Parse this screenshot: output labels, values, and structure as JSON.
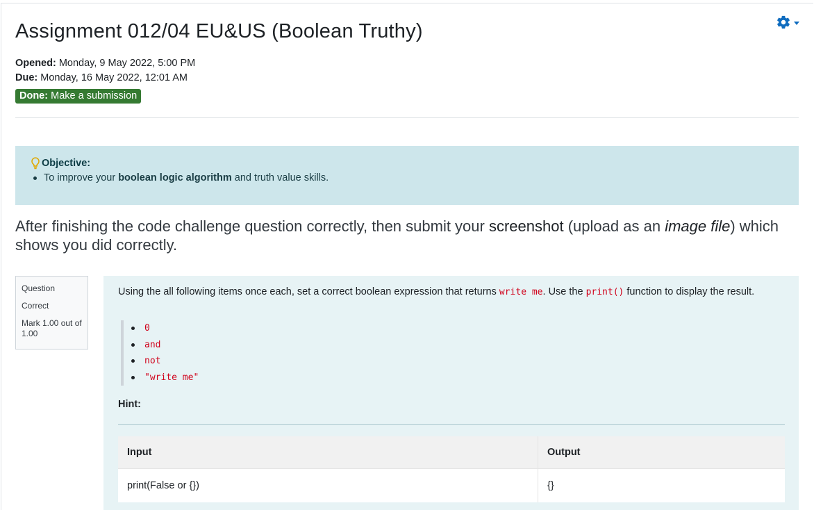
{
  "page": {
    "title": "Assignment 012/04 EU&US (Boolean Truthy)",
    "opened_label": "Opened:",
    "opened_value": "Monday, 9 May 2022, 5:00 PM",
    "due_label": "Due:",
    "due_value": "Monday, 16 May 2022, 12:01 AM",
    "done_label": "Done:",
    "done_value": "Make a submission",
    "done_color": "#357a32"
  },
  "toolbar": {
    "settings_icon": "gear-icon",
    "accent": "#0f6cbf"
  },
  "objective": {
    "icon": "lightbulb-icon",
    "title": "Objective:",
    "item_prefix": "To improve your",
    "item_bold": "boolean logic algorithm",
    "item_suffix": "and truth value skills.",
    "background": "#cde6eb"
  },
  "instructions": {
    "part1": "After finishing the code challenge question correctly, then submit your",
    "strong": "screenshot",
    "part2": "(upload as an",
    "emph": "image file",
    "part3": ") which shows you did correctly."
  },
  "question_info": {
    "label": "Question",
    "state": "Correct",
    "mark": "Mark 1.00 out of 1.00"
  },
  "question": {
    "text_1": "Using the all following items once each, set a correct boolean expression that returns",
    "code_1": "write me",
    "text_2": ". Use the",
    "code_2": "print()",
    "text_3": "function to display the result.",
    "items": [
      "0",
      "and",
      "not",
      "\"write me\""
    ],
    "hint_label": "Hint:",
    "table": {
      "headers": [
        "Input",
        "Output"
      ],
      "rows": [
        [
          "print(False or {})",
          "{}"
        ]
      ]
    }
  }
}
